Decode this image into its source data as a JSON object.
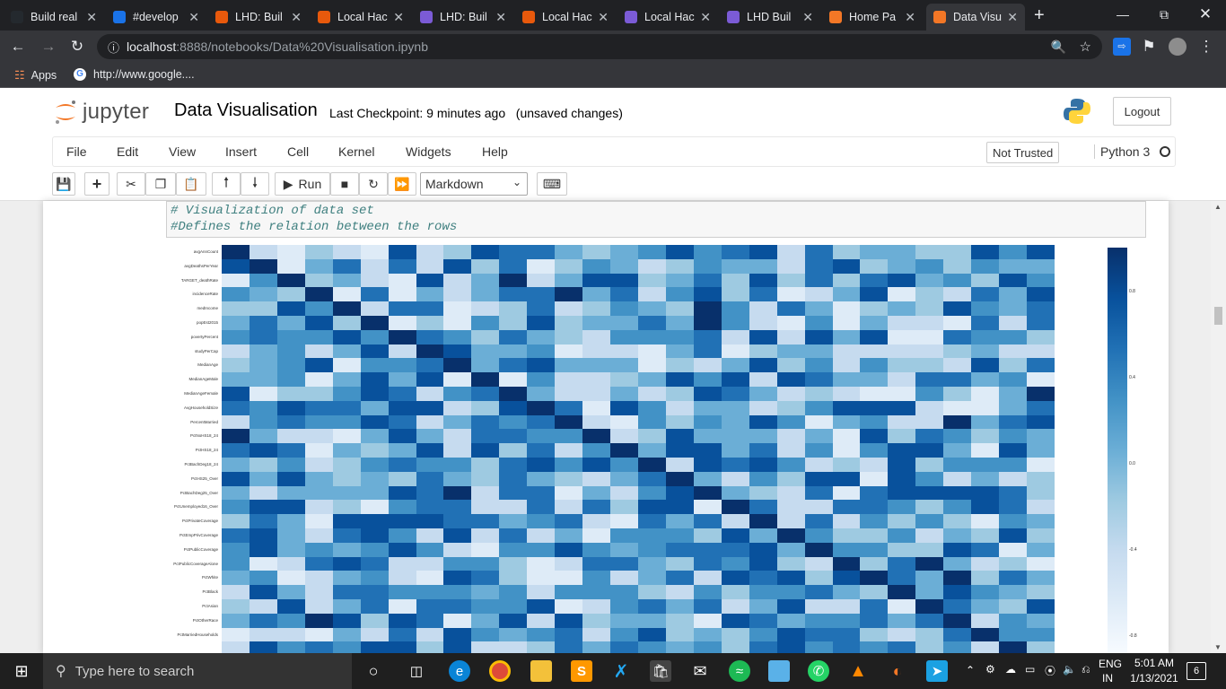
{
  "browser": {
    "tabs": [
      {
        "title": "Build real",
        "favicon": "github-icon",
        "color": "#24292e",
        "active": false
      },
      {
        "title": "#develop",
        "favicon": "calendar-14-icon",
        "color": "#1a73e8",
        "active": false
      },
      {
        "title": "LHD: Buil",
        "favicon": "wand-icon",
        "color": "#e8590c",
        "active": false
      },
      {
        "title": "Local Hac",
        "favicon": "wand-icon",
        "color": "#e8590c",
        "active": false
      },
      {
        "title": "LHD: Buil",
        "favicon": "list-icon",
        "color": "#7b5bd6",
        "active": false
      },
      {
        "title": "Local Hac",
        "favicon": "wand-icon",
        "color": "#e8590c",
        "active": false
      },
      {
        "title": "Local Hac",
        "favicon": "list-icon",
        "color": "#7b5bd6",
        "active": false
      },
      {
        "title": "LHD Buil",
        "favicon": "list-icon",
        "color": "#7b5bd6",
        "active": false
      },
      {
        "title": "Home Pa",
        "favicon": "jupyter-icon",
        "color": "#f37726",
        "active": false
      },
      {
        "title": "Data Visu",
        "favicon": "notebook-icon",
        "color": "#f37726",
        "active": true
      }
    ],
    "new_tab": "+",
    "address": {
      "host": "localhost",
      "path": ":8888/notebooks/Data%20Visualisation.ipynb"
    },
    "bookmarks": [
      {
        "label": "Apps",
        "icon": "apps-grid-icon"
      },
      {
        "label": "http://www.google....",
        "icon": "google-icon"
      }
    ]
  },
  "jupyter": {
    "logo_text": "jupyter",
    "notebook_title": "Data Visualisation",
    "checkpoint": "Last Checkpoint: 9 minutes ago",
    "unsaved": "(unsaved changes)",
    "logout": "Logout",
    "menus": [
      "File",
      "Edit",
      "View",
      "Insert",
      "Cell",
      "Kernel",
      "Widgets",
      "Help"
    ],
    "trust": "Not Trusted",
    "kernel": "Python 3",
    "run_label": "Run",
    "cell_type": "Markdown"
  },
  "cell": {
    "lines": [
      "# Visualization of data set",
      "#Defines the relation between the rows"
    ]
  },
  "heatmap": {
    "row_labels": [
      "avgAnnCount",
      "avgDeathsPerYear",
      "TARGET_deathRate",
      "incidenceRate",
      "medIncome",
      "popEst2015",
      "povertyPercent",
      "studyPerCap",
      "MedianAge",
      "MedianAgeMale",
      "MedianAgeFemale",
      "AvgHouseholdSize",
      "PercentMarried",
      "PctNoHS18_24",
      "PctHS18_24",
      "PctBachDeg18_24",
      "PctHS25_Over",
      "PctBachDeg25_Over",
      "PctUnemployed16_Over",
      "PctPrivateCoverage",
      "PctEmpPrivCoverage",
      "PctPublicCoverage",
      "PctPublicCoverageAlone",
      "PctWhite",
      "PctBlack",
      "PctAsian",
      "PctOtherRace",
      "PctMarriedHouseholds"
    ],
    "colorbar_ticks": [
      "0.8",
      "0.4",
      "0.0",
      "-0.4",
      "-0.8"
    ],
    "colorscale": [
      "#f7fbff",
      "#deebf7",
      "#c6dbef",
      "#9ecae1",
      "#6baed6",
      "#4292c6",
      "#2171b5",
      "#08519c",
      "#08306b"
    ]
  },
  "taskbar": {
    "search_placeholder": "Type here to search",
    "language": "ENG",
    "region": "IN",
    "time": "5:01 AM",
    "date": "1/13/2021",
    "notifications": "6"
  }
}
